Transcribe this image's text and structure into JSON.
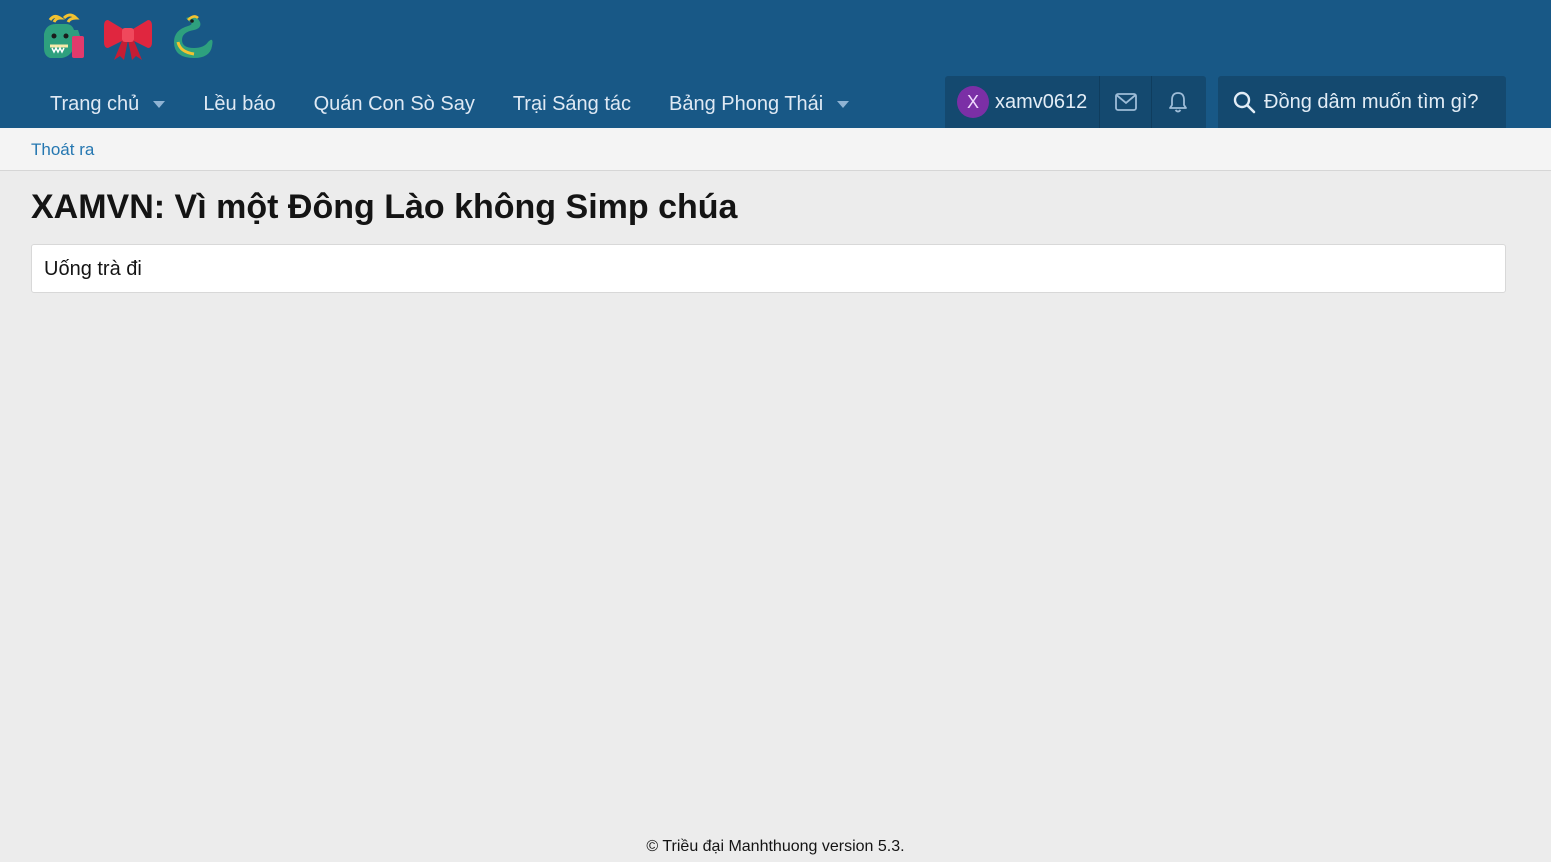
{
  "header": {
    "logo_emojis": [
      "dragon-icon",
      "ribbon-icon",
      "snake-icon"
    ],
    "nav_items": [
      {
        "label": "Trang chủ",
        "has_dropdown": true
      },
      {
        "label": "Lều báo",
        "has_dropdown": false
      },
      {
        "label": "Quán Con Sò Say",
        "has_dropdown": false
      },
      {
        "label": "Trại Sáng tác",
        "has_dropdown": false
      },
      {
        "label": "Bảng Phong Thái",
        "has_dropdown": true
      }
    ],
    "user": {
      "avatar_letter": "X",
      "username": "xamv0612",
      "avatar_color": "#7b2fa6"
    },
    "search_placeholder": "Đồng dâm muốn tìm gì?"
  },
  "subnav": {
    "link": "Thoát ra"
  },
  "main": {
    "title": "XAMVN: Vì một Đông Lào không Simp chúa",
    "block_text": "Uống trà đi"
  },
  "footer": {
    "text": "© Triều đại Manhthuong version 5.3."
  },
  "colors": {
    "header_bg": "#185886",
    "header_control_bg": "#14496f",
    "link": "#2577b1",
    "page_bg": "#ececec"
  }
}
